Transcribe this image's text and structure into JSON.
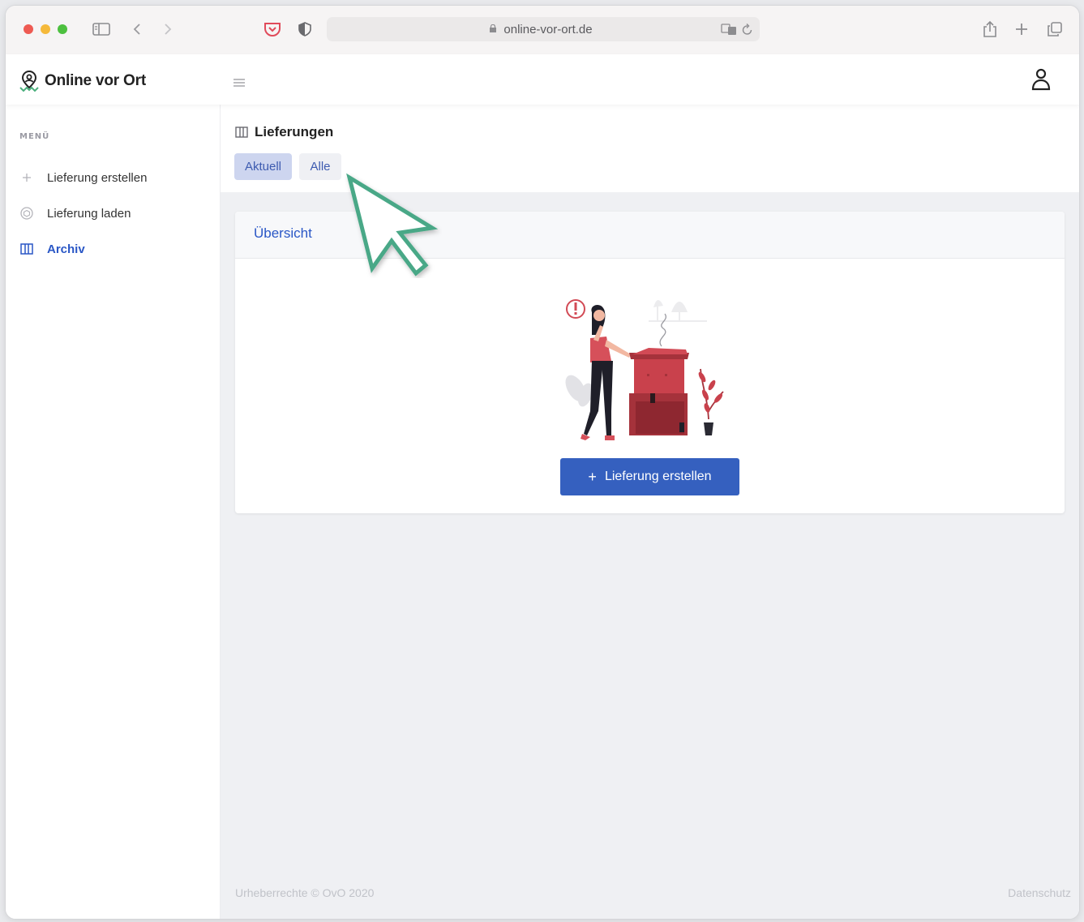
{
  "browser": {
    "url": "online-vor-ort.de",
    "icons": [
      "sidebar-toggle-icon",
      "back-icon",
      "forward-icon",
      "pocket-icon",
      "shield-icon",
      "lock-icon",
      "translate-icon",
      "reload-icon",
      "share-icon",
      "new-tab-icon",
      "tabs-overview-icon"
    ]
  },
  "app": {
    "brand": "Online vor Ort",
    "accent_color": "#2a57c6",
    "button_color": "#3560bf"
  },
  "sidebar": {
    "menu_label": "MENÜ",
    "items": [
      {
        "label": "Lieferung erstellen",
        "icon": "plus-icon",
        "active": false
      },
      {
        "label": "Lieferung laden",
        "icon": "package-icon",
        "active": false
      },
      {
        "label": "Archiv",
        "icon": "archive-icon",
        "active": true
      }
    ]
  },
  "main": {
    "title": "Lieferungen",
    "tabs": [
      {
        "label": "Aktuell",
        "selected": true
      },
      {
        "label": "Alle",
        "selected": false
      }
    ],
    "card": {
      "title": "Übersicht",
      "illustration": "woman-with-boxes-illustration",
      "button_label": "Lieferung erstellen"
    }
  },
  "footer": {
    "copyright": "Urheberrechte © OvO 2020",
    "privacy_link": "Datenschutz"
  }
}
